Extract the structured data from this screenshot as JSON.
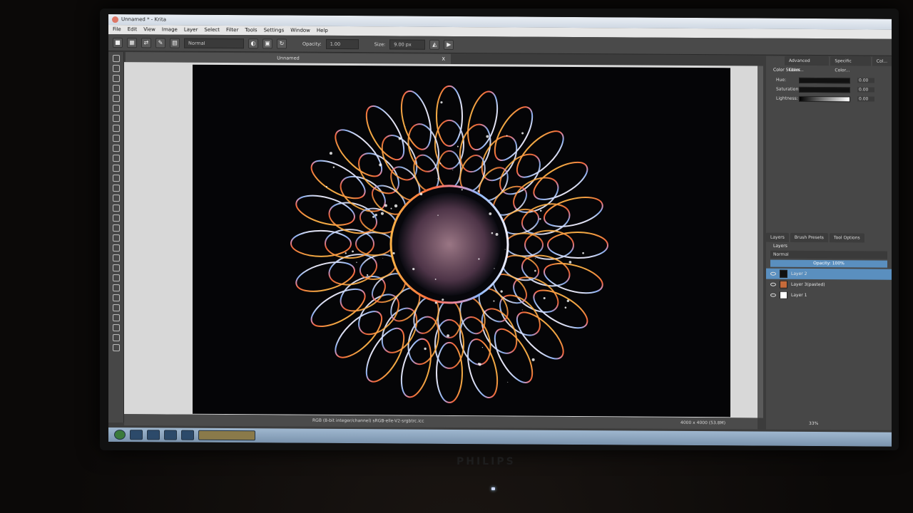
{
  "window": {
    "title": "Unnamed * - Krita"
  },
  "menu": [
    "File",
    "Edit",
    "View",
    "Image",
    "Layer",
    "Select",
    "Filter",
    "Tools",
    "Settings",
    "Window",
    "Help"
  ],
  "toolbar": {
    "blend_mode": "Normal",
    "opacity_label": "Opacity:",
    "opacity_value": "1.00",
    "size_label": "Size:",
    "size_value": "9.00 px"
  },
  "document": {
    "tab_name": "Unnamed",
    "close_glyph": "X"
  },
  "status": {
    "color_info": "RGB (8-bit integer/channel)  sRGB-elle-V2-srgbtrc.icc",
    "dimensions": "4000 x 4000 (53.8M)",
    "zoom": "33%"
  },
  "dock_top_tabs": [
    "Advanced Color...",
    "Specific Color...",
    "Col..."
  ],
  "color_sliders": {
    "title": "Color Sliders",
    "rows": [
      {
        "label": "Hue:",
        "value": "0.00"
      },
      {
        "label": "Saturation:",
        "value": "0.00"
      },
      {
        "label": "Lightness:",
        "value": "0.00"
      }
    ]
  },
  "dock_bottom_tabs": [
    "Layers",
    "Brush Presets",
    "Tool Options"
  ],
  "layers": {
    "title": "Layers",
    "blend_mode": "Normal",
    "opacity": "Opacity: 100%",
    "items": [
      {
        "name": "Layer 2",
        "selected": true
      },
      {
        "name": "Layer 3(pasted)",
        "selected": false
      },
      {
        "name": "Layer 1",
        "selected": false
      }
    ]
  },
  "monitor": {
    "brand": "PHILIPS"
  },
  "colors": {
    "ui_dark": "#474747",
    "selection": "#5a8fbf",
    "canvas_bg": "#050507"
  }
}
